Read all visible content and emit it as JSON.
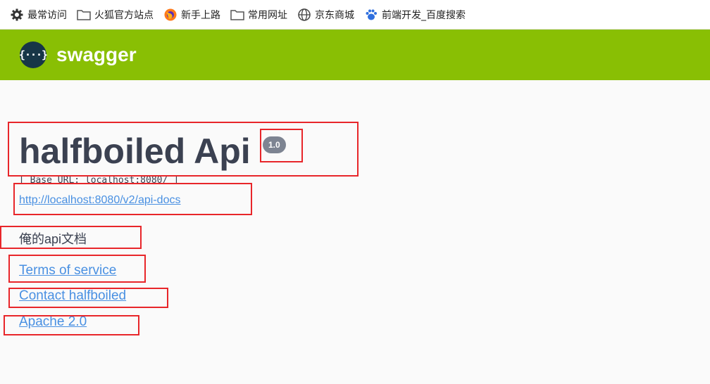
{
  "bookmarks": [
    {
      "label": "最常访问",
      "icon": "gear-icon"
    },
    {
      "label": "火狐官方站点",
      "icon": "folder-icon"
    },
    {
      "label": "新手上路",
      "icon": "firefox-icon"
    },
    {
      "label": "常用网址",
      "icon": "folder-icon"
    },
    {
      "label": "京东商城",
      "icon": "globe-icon"
    },
    {
      "label": "前端开发_百度搜索",
      "icon": "baidu-paw-icon"
    }
  ],
  "header": {
    "brand": "swagger",
    "logo_glyph": "{···}",
    "background": "#89bf04"
  },
  "info": {
    "title": "halfboiled Api",
    "version": "1.0",
    "base_url": "[ Base URL: localhost:8080/ ]",
    "api_docs_link": "http://localhost:8080/v2/api-docs",
    "description": "俺的api文档",
    "terms_link": "Terms of service",
    "contact_link": "Contact halfboiled",
    "license_link": "Apache 2.0"
  },
  "colors": {
    "link": "#4990e2",
    "annotation": "#e8262a",
    "title": "#3b4151"
  }
}
